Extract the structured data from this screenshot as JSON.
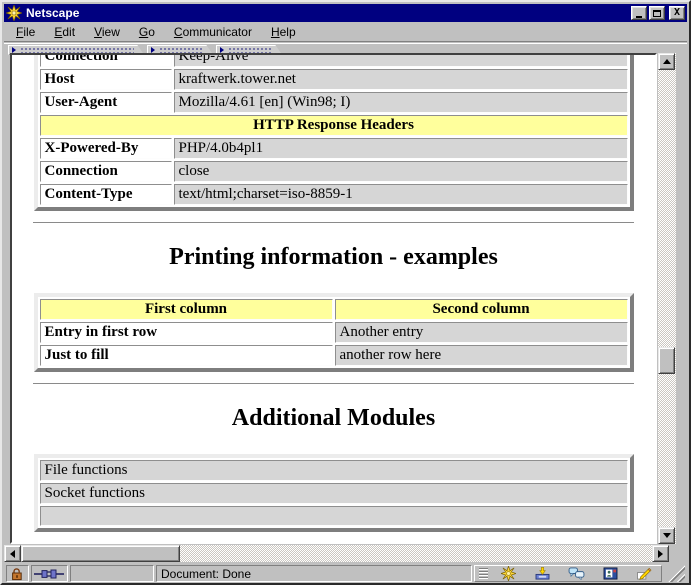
{
  "window": {
    "title": "Netscape"
  },
  "menu": {
    "items": [
      "File",
      "Edit",
      "View",
      "Go",
      "Communicator",
      "Help"
    ]
  },
  "toolbars": {
    "collapsed_tabs": [
      "navigation-toolbar",
      "location-toolbar",
      "personal-toolbar"
    ]
  },
  "page": {
    "http_table": {
      "request_rows": [
        {
          "label": "Connection",
          "value": "Keep-Alive"
        },
        {
          "label": "Host",
          "value": "kraftwerk.tower.net"
        },
        {
          "label": "User-Agent",
          "value": "Mozilla/4.61 [en] (Win98; I)"
        }
      ],
      "response_header": "HTTP Response Headers",
      "response_rows": [
        {
          "label": "X-Powered-By",
          "value": "PHP/4.0b4pl1"
        },
        {
          "label": "Connection",
          "value": "close"
        },
        {
          "label": "Content-Type",
          "value": "text/html;charset=iso-8859-1"
        }
      ]
    },
    "printing_section": {
      "title": "Printing information - examples",
      "table": {
        "headers": [
          "First column",
          "Second column"
        ],
        "rows": [
          [
            "Entry in first row",
            "Another entry"
          ],
          [
            "Just to fill",
            "another row here"
          ]
        ]
      }
    },
    "modules_section": {
      "title": "Additional Modules",
      "rows": [
        "File functions",
        "Socket functions",
        ""
      ]
    },
    "colors": {
      "header_yellow": "#ffff9c",
      "cell_gray": "#d6d6d6",
      "titlebar_blue": "#000080"
    }
  },
  "statusbar": {
    "message": "Document: Done"
  },
  "icons": {
    "titlebar": "netscape-logo-icon",
    "status_left": [
      "security-lock-icon",
      "online-plug-icon"
    ],
    "component_bar": [
      "navigator-icon",
      "inbox-icon",
      "discussions-icon",
      "address-book-icon",
      "composer-icon"
    ]
  }
}
